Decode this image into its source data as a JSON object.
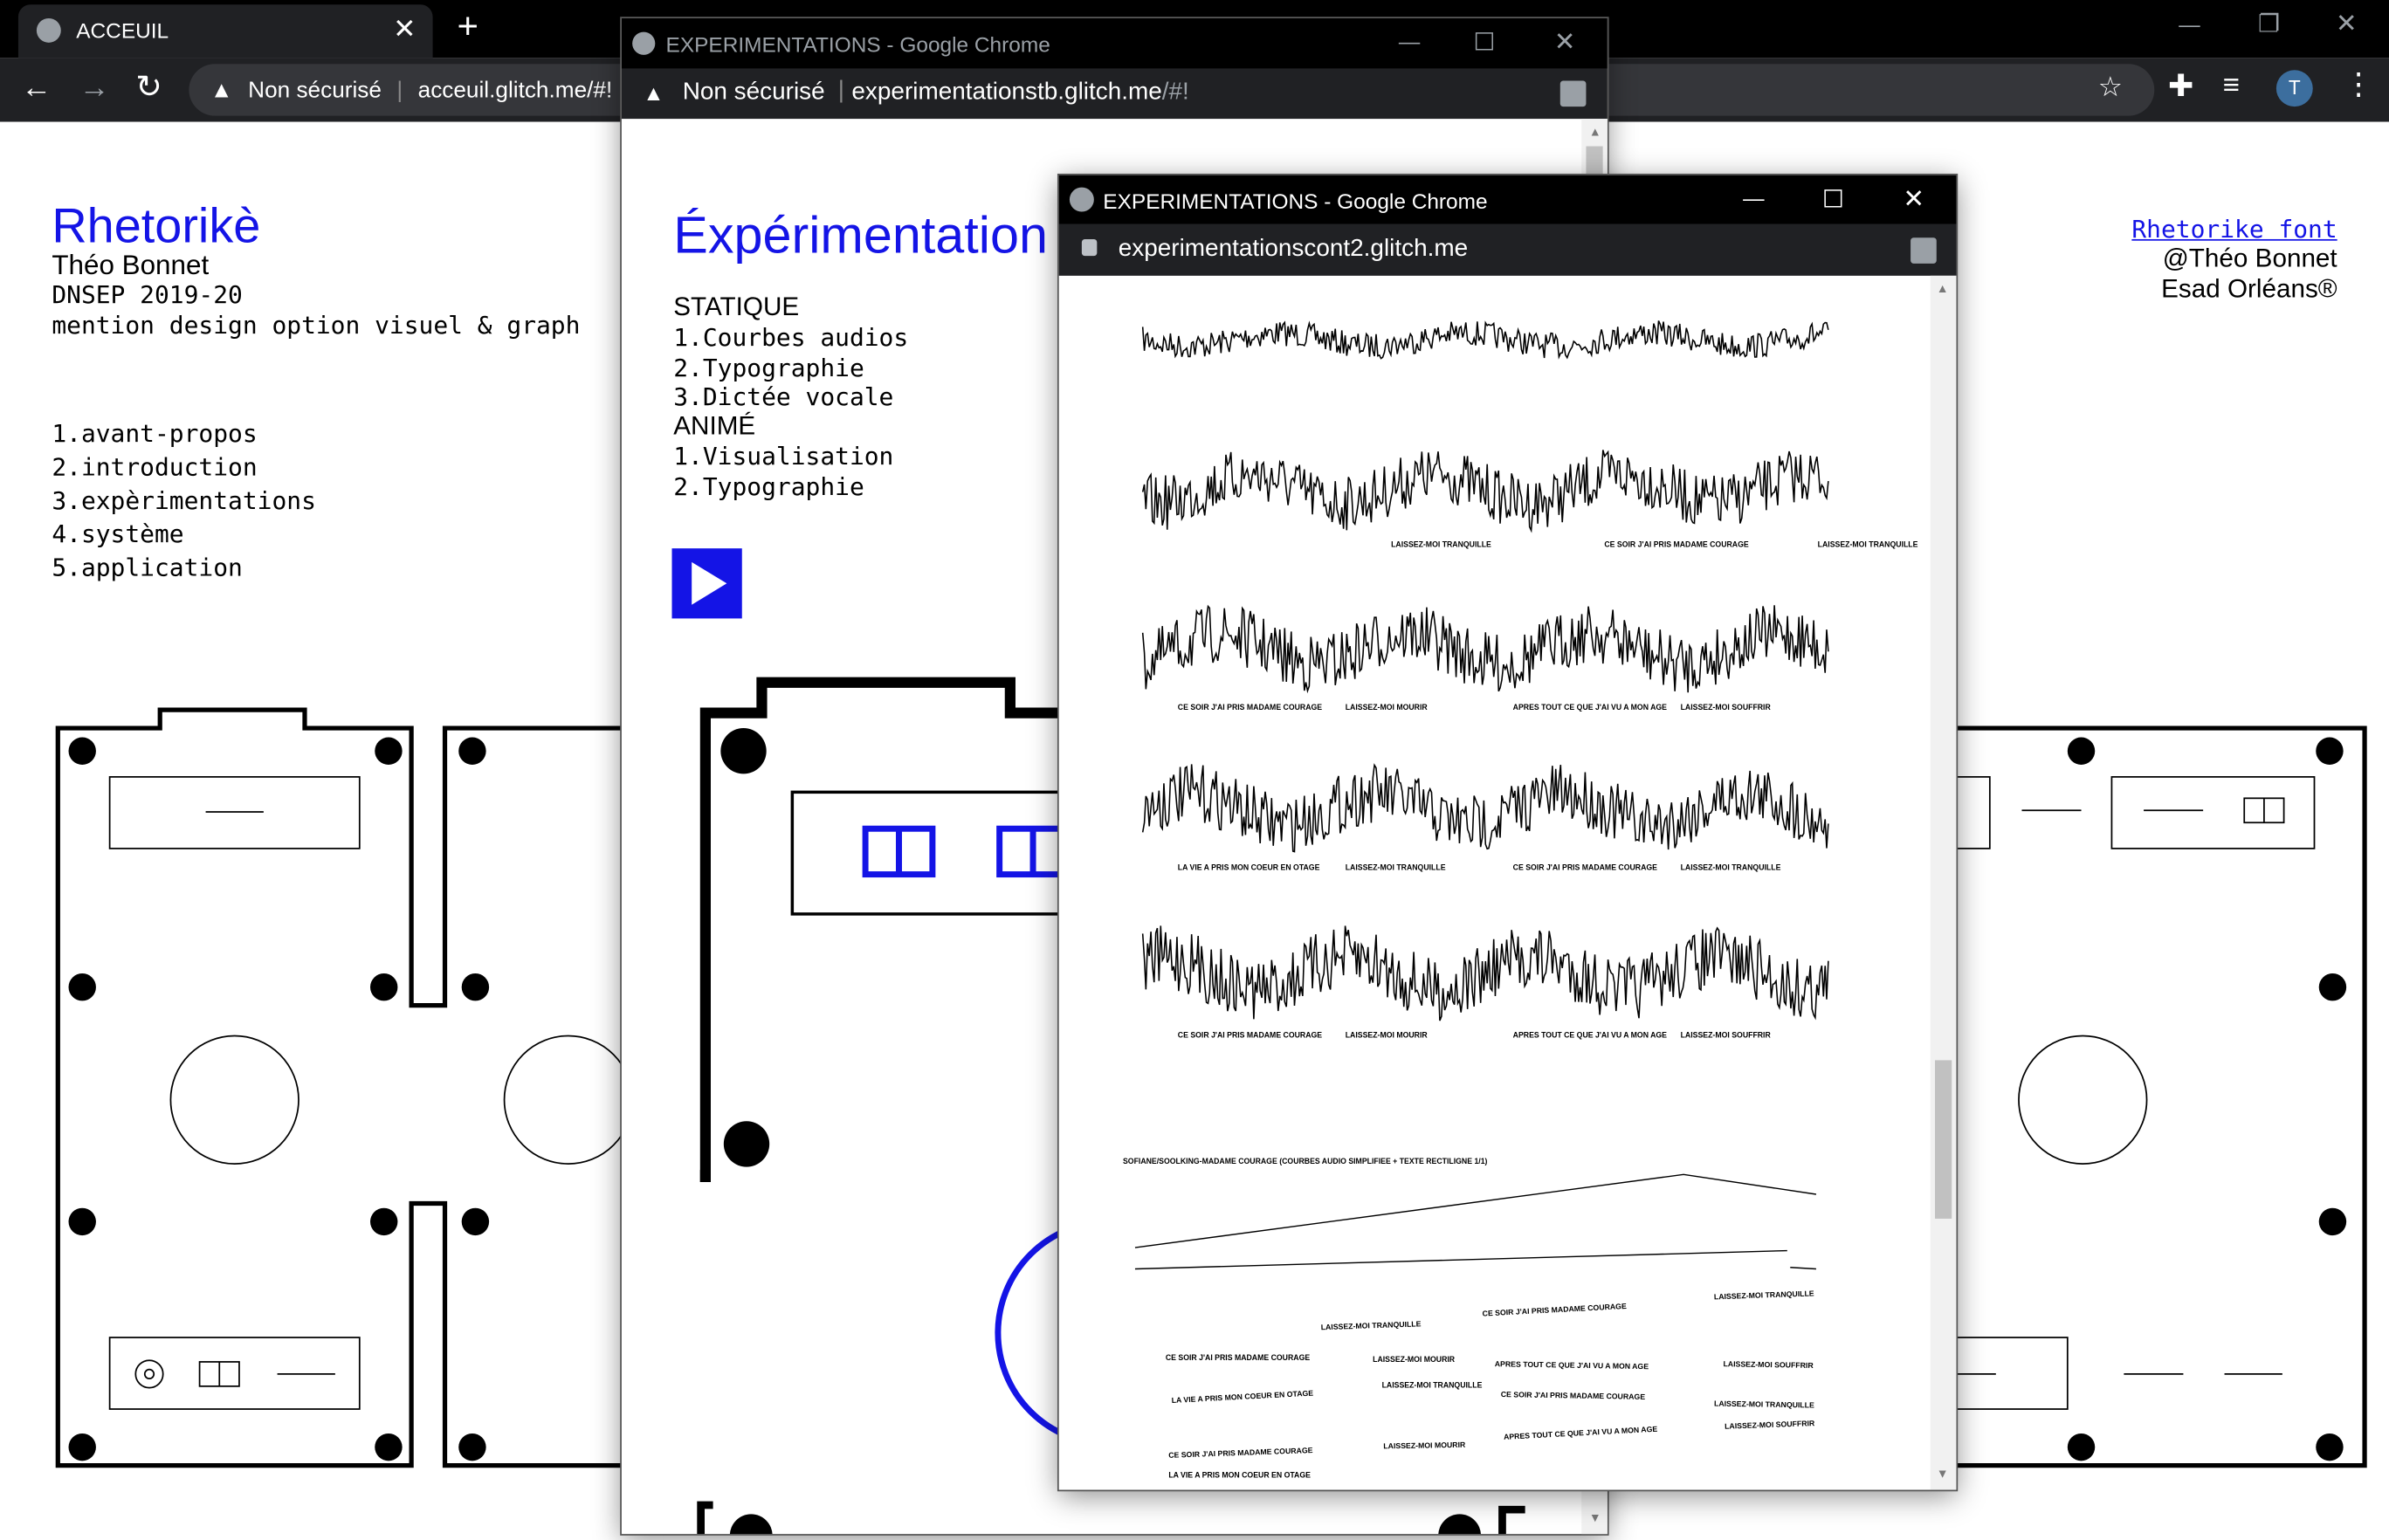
{
  "main_window": {
    "tab_title": "ACCEUIL",
    "security_label": "Non sécurisé",
    "url": "acceuil.glitch.me/#!",
    "profile_initial": "T",
    "icons": [
      "globe-icon",
      "close-icon",
      "plus-icon",
      "back-icon",
      "forward-icon",
      "reload-icon",
      "warning-icon",
      "star-icon",
      "extensions-icon",
      "media-icon",
      "menu-icon",
      "minimize-icon",
      "restore-icon",
      "close-window-icon"
    ]
  },
  "left_page": {
    "title": "Rhetorikè",
    "author": "Théo Bonnet",
    "degree": "DNSEP 2019-20",
    "mention": "mention design option visuel & graph",
    "nav": [
      {
        "label": "1.avant-propos"
      },
      {
        "label": "2.introduction"
      },
      {
        "label": "3.expèrimentations"
      },
      {
        "label": "4.système"
      },
      {
        "label": "5.application"
      }
    ],
    "font_link": "Rhetorike font",
    "credit": "@Théo Bonnet",
    "school": "Esad Orléans®"
  },
  "window2": {
    "title": "EXPERIMENTATIONS - Google Chrome",
    "security_label": "Non sécurisé",
    "url_main": "experimentationstb.glitch.me",
    "url_hash": "/#!",
    "heading": "Éxpérimentation",
    "static_heading": "STATIQUE",
    "static_items": [
      {
        "label": "1.Courbes audios"
      },
      {
        "label": "2.Typographie"
      },
      {
        "label": "3.Dictée vocale"
      }
    ],
    "animated_heading": "ANIMÉ",
    "animated_items": [
      {
        "label": "1.Visualisation"
      },
      {
        "label": "2.Typographie"
      }
    ]
  },
  "window3": {
    "title": "EXPERIMENTATIONS - Google Chrome",
    "url": "experimentationscont2.glitch.me",
    "waves": [
      {
        "labels": []
      },
      {
        "labels": [
          "LAISSEZ-MOI TRANQUILLE",
          "CE SOIR J'AI PRIS MADAME COURAGE",
          "LAISSEZ-MOI TRANQUILLE"
        ]
      },
      {
        "labels": [
          "CE SOIR J'AI PRIS MADAME COURAGE",
          "LAISSEZ-MOI MOURIR",
          "APRES TOUT CE QUE J'AI VU A MON AGE",
          "LAISSEZ-MOI SOUFFRIR"
        ]
      },
      {
        "labels": [
          "LA VIE A PRIS MON COEUR EN OTAGE",
          "LAISSEZ-MOI TRANQUILLE",
          "CE SOIR J'AI PRIS MADAME COURAGE",
          "LAISSEZ-MOI TRANQUILLE"
        ]
      },
      {
        "labels": [
          "CE SOIR J'AI PRIS MADAME COURAGE",
          "LAISSEZ-MOI MOURIR",
          "APRES TOUT CE QUE J'AI VU A MON AGE",
          "LAISSEZ-MOI SOUFFRIR"
        ]
      }
    ],
    "caption": "SOFIANE/SOOLKING-MADAME COURAGE (COURBES AUDIO SIMPLIFIEE + TEXTE RECTILIGNE 1/1)",
    "scatter": [
      {
        "text": "LAISSEZ-MOI TRANQUILLE"
      },
      {
        "text": "CE SOIR J'AI PRIS MADAME COURAGE"
      },
      {
        "text": "LAISSEZ-MOI TRANQUILLE"
      },
      {
        "text": "CE SOIR J'AI PRIS MADAME COURAGE"
      },
      {
        "text": "LAISSEZ-MOI MOURIR"
      },
      {
        "text": "APRES TOUT CE QUE J'AI VU A MON AGE"
      },
      {
        "text": "LAISSEZ-MOI SOUFFRIR"
      },
      {
        "text": "LA VIE A PRIS MON COEUR EN OTAGE"
      },
      {
        "text": "LAISSEZ-MOI TRANQUILLE"
      },
      {
        "text": "CE SOIR J'AI PRIS MADAME COURAGE"
      },
      {
        "text": "LAISSEZ-MOI TRANQUILLE"
      },
      {
        "text": "LAISSEZ-MOI SOUFFRIR"
      },
      {
        "text": "CE SOIR J'AI PRIS MADAME COURAGE"
      },
      {
        "text": "LAISSEZ-MOI MOURIR"
      },
      {
        "text": "APRES TOUT CE QUE J'AI VU A MON AGE"
      },
      {
        "text": "LA VIE A PRIS MON COEUR EN OTAGE"
      }
    ]
  },
  "colors": {
    "accent": "#1414e6",
    "chrome_dark": "#202124",
    "title_black": "#000000"
  }
}
